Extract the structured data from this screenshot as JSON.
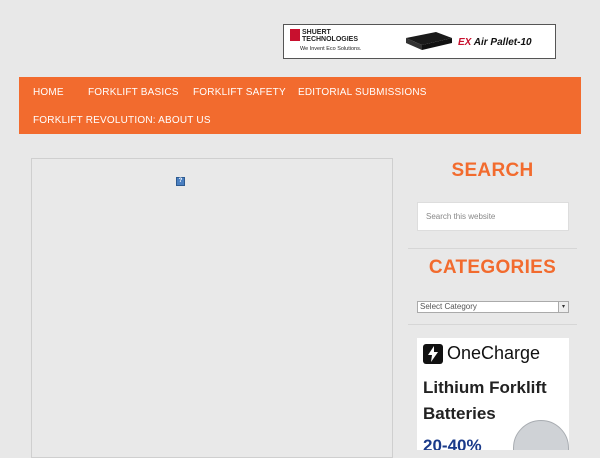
{
  "banner": {
    "company_line1": "SHUERT",
    "company_line2": "TECHNOLOGIES",
    "tagline": "We Invent Eco Solutions.",
    "product_prefix": "EX",
    "product_name": "Air Pallet-10"
  },
  "nav": {
    "items": [
      {
        "label": "HOME"
      },
      {
        "label": "FORKLIFT BASICS"
      },
      {
        "label": "FORKLIFT SAFETY"
      },
      {
        "label": "EDITORIAL SUBMISSIONS"
      },
      {
        "label": "FORKLIFT REVOLUTION: ABOUT US"
      }
    ],
    "background": "#f26b2e"
  },
  "sidebar": {
    "search_title": "SEARCH",
    "search_placeholder": "Search this website",
    "categories_title": "CATEGORIES",
    "categories_selected": "Select Category",
    "accent": "#f26b2e"
  },
  "ad": {
    "brand": "OneCharge",
    "line1": "Lithium Forklift",
    "line2": "Batteries",
    "line3": "20-40%"
  },
  "content": {
    "broken_image_glyph": "?"
  }
}
